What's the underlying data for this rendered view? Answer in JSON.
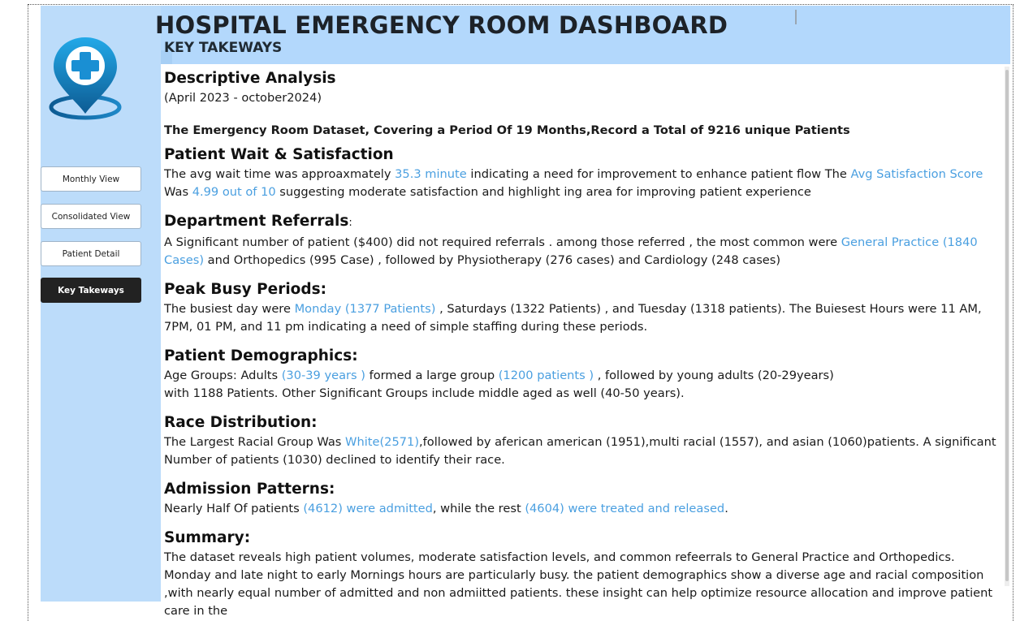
{
  "header": {
    "title": "HOSPITAL EMERGENCY ROOM DASHBOARD",
    "subtitle": "KEY TAKEWAYS"
  },
  "sidebar": {
    "logo_icon": "hospital-location-pin-icon",
    "nav": [
      {
        "label": "Monthly View",
        "active": false
      },
      {
        "label": "Consolidated View",
        "active": false
      },
      {
        "label": "Patient Detail",
        "active": false
      },
      {
        "label": "Key Takeways",
        "active": true
      }
    ]
  },
  "colors": {
    "sidebar_bg": "#bcdcfa",
    "header_bg": "#b3d8fc",
    "highlight": "#4a9fe0",
    "active_nav": "#222222"
  },
  "content": {
    "descriptive": {
      "heading": "Descriptive Analysis",
      "period": "(April 2023  -  october2024)",
      "dataset": "The Emergency Room Dataset, Covering a Period Of 19 Months,Record a Total of 9216 unique Patients"
    },
    "wait": {
      "heading": "Patient Wait & Satisfaction",
      "t1": "The avg wait time was approaxmately ",
      "h1": "35.3 minute",
      "t2": " indicating a need for improvement to enhance patient flow The ",
      "h2": "Avg Satisfaction Score",
      "t3": " Was ",
      "h3": "4.99 out of 10",
      "t4": " suggesting moderate satisfaction and highlight ing area for improving patient experience"
    },
    "referrals": {
      "heading": "Department Referrals",
      "heading_suffix": ":",
      "t1": "A Significant number of patient ($400) did not required  referrals . among those referred , the most common were ",
      "h1": "General Practice (1840 Cases)",
      "t2": " and Orthopedics (995 Case) , followed by Physiotherapy (276 cases) and Cardiology (248 cases)"
    },
    "peak": {
      "heading": "Peak Busy Periods:",
      "t1": "The busiest day were ",
      "h1": "Monday (1377 Patients)",
      "t2": " , Saturdays (1322 Patients) , and Tuesday (1318 patients). The Buiesest Hours were 11 AM, 7PM, 01 PM, and 11 pm indicating a need of simple staffing during these periods."
    },
    "demographics": {
      "heading": "Patient Demographics:",
      "t1": "Age Groups: Adults ",
      "h1": "(30-39 years )",
      "t2": " formed a large group ",
      "h2": "(1200 patients )",
      "t3": " , followed by young adults (20-29years)",
      "line2": "with 1188 Patients. Other Significant Groups include middle aged as well (40-50 years)."
    },
    "race": {
      "heading": "Race Distribution:",
      "t1": "The Largest Racial Group Was ",
      "h1": "White(2571)",
      "t2": ",followed by aferican american (1951),multi racial (1557), and asian (1060)patients. A significant Number of patients (1030) declined to identify their race."
    },
    "admission": {
      "heading": "Admission Patterns:",
      "t1": "Nearly Half Of patients ",
      "h1": "(4612) were admitted",
      "t2": ", while the rest ",
      "h2": "(4604) were treated and released",
      "t3": "."
    },
    "summary": {
      "heading": "Summary:",
      "text": "The dataset reveals high patient volumes, moderate satisfaction levels, and common refeerrals to General Practice and Orthopedics. Monday and late night to early Mornings hours are particularly busy. the patient demographics show a diverse age and racial composition ,with nearly equal number of admitted and non admiitted patients. these insight can help optimize resource allocation and improve patient care in the"
    }
  }
}
